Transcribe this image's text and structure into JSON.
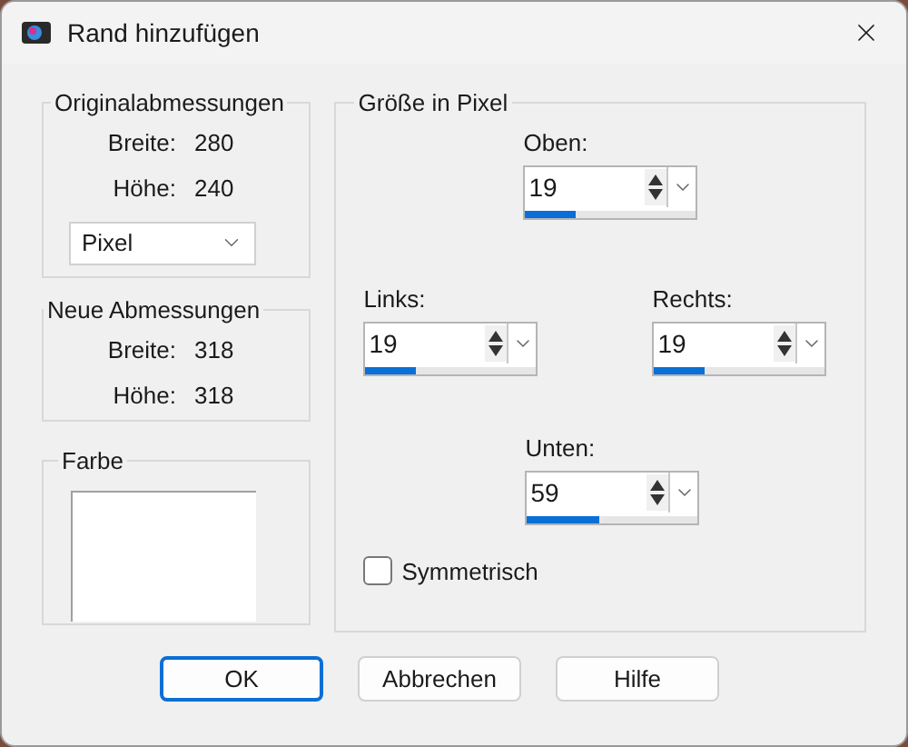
{
  "window": {
    "title": "Rand hinzufügen"
  },
  "original": {
    "title": "Originalabmessungen",
    "rows": [
      {
        "label": "Breite:",
        "value": "280"
      },
      {
        "label": "Höhe:",
        "value": "240"
      }
    ],
    "unit": {
      "value": "Pixel"
    }
  },
  "new": {
    "title": "Neue Abmessungen",
    "rows": [
      {
        "label": "Breite:",
        "value": "318"
      },
      {
        "label": "Höhe:",
        "value": "318"
      }
    ]
  },
  "color": {
    "title": "Farbe"
  },
  "size": {
    "title": "Größe in Pixel",
    "fields": [
      {
        "label": "Oben:",
        "value": "19",
        "level": 0.3
      },
      {
        "label": "Links:",
        "value": "19",
        "level": 0.3
      },
      {
        "label": "Rechts:",
        "value": "19",
        "level": 0.3
      },
      {
        "label": "Unten:",
        "value": "59",
        "level": 0.42
      }
    ],
    "symmetric": {
      "label": "Symmetrisch",
      "checked": false
    }
  },
  "buttons": [
    {
      "label": "OK",
      "default": true
    },
    {
      "label": "Abbrechen",
      "default": false
    },
    {
      "label": "Hilfe",
      "default": false
    }
  ]
}
